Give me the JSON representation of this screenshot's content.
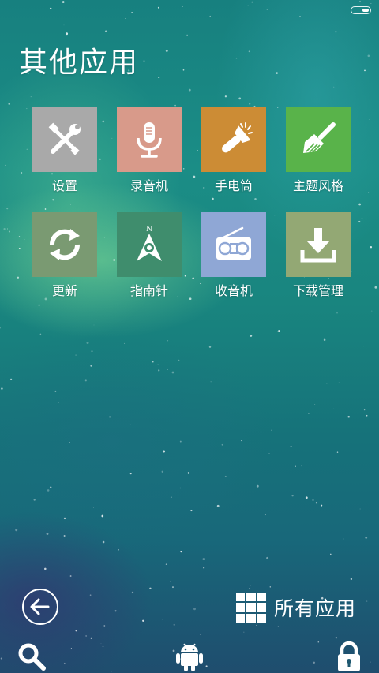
{
  "status_bar": {
    "battery_icon": "battery-icon"
  },
  "header": {
    "title": "其他应用"
  },
  "apps": [
    {
      "label": "设置",
      "icon": "settings-tools-icon",
      "color": "#a9a9a9"
    },
    {
      "label": "录音机",
      "icon": "microphone-icon",
      "color": "#d89a8a"
    },
    {
      "label": "手电筒",
      "icon": "flashlight-icon",
      "color": "#cc8c35"
    },
    {
      "label": "主题风格",
      "icon": "brush-icon",
      "color": "#59b34a"
    },
    {
      "label": "更新",
      "icon": "refresh-icon",
      "color": "#7a9a72"
    },
    {
      "label": "指南针",
      "icon": "compass-icon",
      "color": "#3f8d6d"
    },
    {
      "label": "收音机",
      "icon": "radio-icon",
      "color": "#8fa7d5"
    },
    {
      "label": "下载管理",
      "icon": "download-icon",
      "color": "#93a874"
    }
  ],
  "footer": {
    "back_icon": "back-arrow-icon",
    "all_apps_label": "所有应用",
    "all_apps_icon": "grid-icon"
  },
  "bottom_bar": {
    "search_icon": "search-icon",
    "android_icon": "android-icon",
    "lock_icon": "lock-icon"
  }
}
